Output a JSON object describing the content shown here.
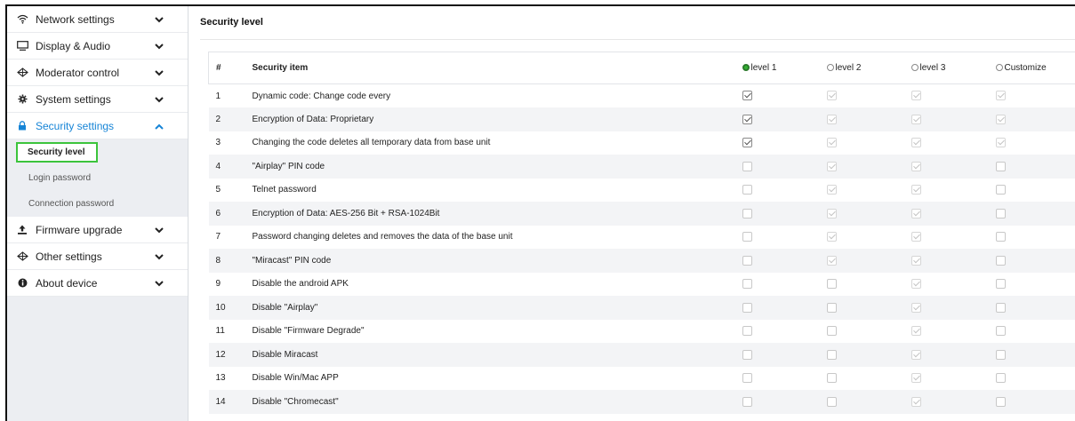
{
  "sidebar": {
    "items": [
      {
        "label": "Network settings",
        "icon": "wifi-icon"
      },
      {
        "label": "Display & Audio",
        "icon": "monitor-icon"
      },
      {
        "label": "Moderator control",
        "icon": "moderator-icon"
      },
      {
        "label": "System settings",
        "icon": "gear-icon"
      },
      {
        "label": "Security settings",
        "icon": "lock-icon",
        "expanded": true
      },
      {
        "label": "Firmware upgrade",
        "icon": "upload-icon"
      },
      {
        "label": "Other settings",
        "icon": "other-settings-icon"
      },
      {
        "label": "About device",
        "icon": "info-icon"
      }
    ],
    "security_subitems": [
      {
        "label": "Security level",
        "selected": true
      },
      {
        "label": "Login password"
      },
      {
        "label": "Connection password"
      }
    ]
  },
  "main": {
    "title": "Security level",
    "table": {
      "headers": {
        "num": "#",
        "item": "Security item"
      },
      "levels": [
        "level 1",
        "level 2",
        "level 3",
        "Customize"
      ],
      "selected_level": 0,
      "rows": [
        {
          "num": "1",
          "item": "Dynamic code: Change code every",
          "checks": [
            "checked",
            "muted",
            "muted",
            "muted"
          ]
        },
        {
          "num": "2",
          "item": "Encryption of Data: Proprietary",
          "checks": [
            "checked",
            "muted",
            "muted",
            "muted"
          ]
        },
        {
          "num": "3",
          "item": "Changing the code deletes all temporary data from base unit",
          "checks": [
            "checked",
            "muted",
            "muted",
            "muted"
          ]
        },
        {
          "num": "4",
          "item": "\"Airplay\" PIN code",
          "checks": [
            "empty",
            "muted",
            "muted",
            "empty"
          ]
        },
        {
          "num": "5",
          "item": "Telnet password",
          "checks": [
            "empty",
            "muted",
            "muted",
            "empty"
          ]
        },
        {
          "num": "6",
          "item": "Encryption of Data: AES-256 Bit + RSA-1024Bit",
          "checks": [
            "empty",
            "muted",
            "muted",
            "empty"
          ]
        },
        {
          "num": "7",
          "item": "Password changing deletes and removes the data of the base unit",
          "checks": [
            "empty",
            "muted",
            "muted",
            "empty"
          ]
        },
        {
          "num": "8",
          "item": "\"Miracast\" PIN code",
          "checks": [
            "empty",
            "muted",
            "muted",
            "empty"
          ]
        },
        {
          "num": "9",
          "item": "Disable the android APK",
          "checks": [
            "empty",
            "empty",
            "muted",
            "empty"
          ]
        },
        {
          "num": "10",
          "item": "Disable \"Airplay\"",
          "checks": [
            "empty",
            "empty",
            "muted",
            "empty"
          ]
        },
        {
          "num": "11",
          "item": "Disable \"Firmware Degrade\"",
          "checks": [
            "empty",
            "empty",
            "muted",
            "empty"
          ]
        },
        {
          "num": "12",
          "item": "Disable Miracast",
          "checks": [
            "empty",
            "empty",
            "muted",
            "empty"
          ]
        },
        {
          "num": "13",
          "item": "Disable Win/Mac APP",
          "checks": [
            "empty",
            "empty",
            "muted",
            "empty"
          ]
        },
        {
          "num": "14",
          "item": "Disable \"Chromecast\"",
          "checks": [
            "empty",
            "empty",
            "muted",
            "empty"
          ]
        }
      ]
    }
  },
  "colors": {
    "accent_blue": "#1684d6",
    "selected_outline_green": "#3cc43c",
    "radio_selected_green": "#33b033",
    "sidebar_bg": "#eceef2"
  }
}
